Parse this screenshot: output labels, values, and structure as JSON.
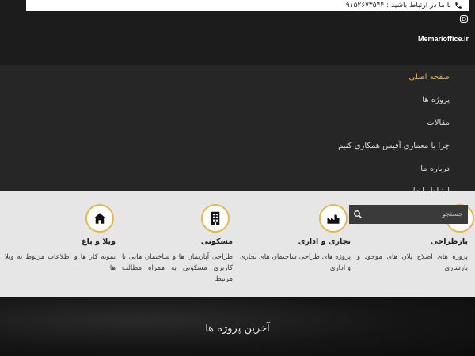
{
  "header": {
    "contact_text": "با ما در ارتباط باشید : ۰۹۱۵۲۶۷۳۵۴۴",
    "site_url": "Memarioffice.ir"
  },
  "menu": {
    "items": [
      {
        "label": "صفحه اصلی",
        "active": true
      },
      {
        "label": "پروژه ها",
        "active": false
      },
      {
        "label": "مقالات",
        "active": false
      },
      {
        "label": "چرا با معماری آفیس همکاری کنیم",
        "active": false
      },
      {
        "label": "درباره ما",
        "active": false
      },
      {
        "label": "ارتباط با ما",
        "active": false
      }
    ]
  },
  "search": {
    "placeholder": "جستجو"
  },
  "services": [
    {
      "icon": "check-square-icon",
      "title": "بازطراحی",
      "desc": "پروژه های اصلاح پلان های موجود و بازسازی"
    },
    {
      "icon": "factory-icon",
      "title": "تجاری و اداری",
      "desc": "پروژه های طراحی ساختمان های تجاری و اداری"
    },
    {
      "icon": "building-icon",
      "title": "مسکونی",
      "desc": "طراحی آپارتمان ها و ساختمان هایی با کاربری مسکونی به همراه مطالب مرتبط"
    },
    {
      "icon": "home-icon",
      "title": "ویلا و باغ",
      "desc": "نمونه کار ها و اطلاعات مربوط به ویلا ها"
    }
  ],
  "latest": {
    "title": "آخرین پروژه ها"
  },
  "colors": {
    "accent": "#e8b64a",
    "dark": "#1c1c1c",
    "menu_bg": "#262626",
    "panel_bg": "#e6e6e6"
  }
}
